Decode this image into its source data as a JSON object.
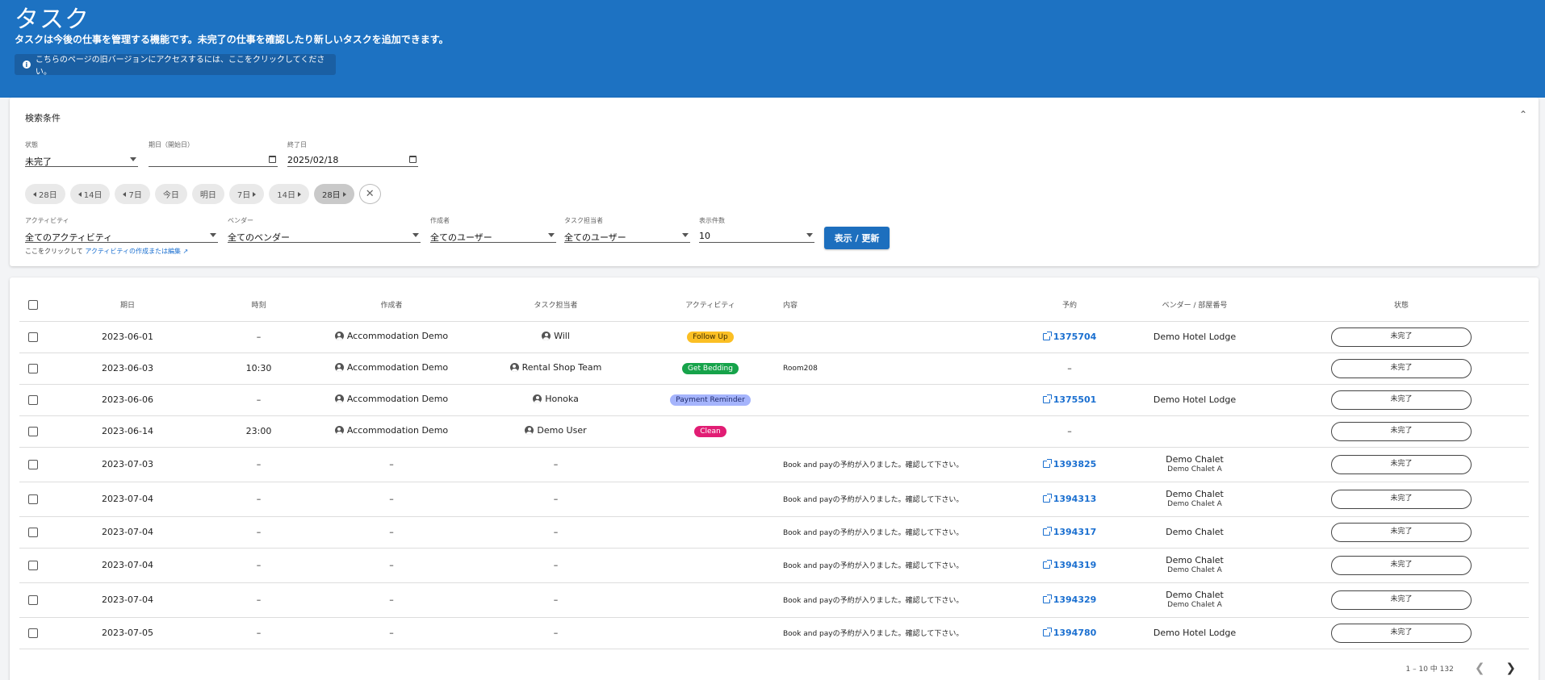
{
  "header": {
    "title": "タスク",
    "subtitle": "タスクは今後の仕事を管理する機能です。未完了の仕事を確認したり新しいタスクを追加できます。",
    "old_version_link": "こちらのページの旧バージョンにアクセスするには、ここをクリックしてください。"
  },
  "filters": {
    "title": "検索条件",
    "status": {
      "label": "状態",
      "value": "未完了"
    },
    "start_date": {
      "label": "期日（開始日）",
      "value": ""
    },
    "end_date": {
      "label": "終了日",
      "value": "2025/02/18"
    },
    "chips": [
      "28日",
      "14日",
      "7日",
      "今日",
      "明日",
      "7日",
      "14日",
      "28日"
    ],
    "activity": {
      "label": "アクティビティ",
      "value": "全てのアクティビティ"
    },
    "vendor": {
      "label": "ベンダー",
      "value": "全てのベンダー"
    },
    "creator": {
      "label": "作成者",
      "value": "全てのユーザー"
    },
    "assignee": {
      "label": "タスク担当者",
      "value": "全てのユーザー"
    },
    "per_page": {
      "label": "表示件数",
      "value": "10"
    },
    "help_prefix": "ここをクリックして",
    "help_link": "アクティビティの作成または編集",
    "submit_label": "表示 / 更新"
  },
  "table": {
    "columns": [
      "期日",
      "時刻",
      "作成者",
      "タスク担当者",
      "アクティビティ",
      "内容",
      "予約",
      "ベンダー / 部屋番号",
      "状態"
    ],
    "rows": [
      {
        "date": "2023-06-01",
        "time": "–",
        "creator": "Accommodation Demo",
        "assignee": "Will",
        "activity": "Follow Up",
        "content": "",
        "reservation": "1375704",
        "vendor": "Demo Hotel Lodge",
        "room": "",
        "status": "未完了"
      },
      {
        "date": "2023-06-03",
        "time": "10:30",
        "creator": "Accommodation Demo",
        "assignee": "Rental Shop Team",
        "activity": "Get Bedding",
        "content": "Room208",
        "reservation": "",
        "vendor": "",
        "room": "",
        "status": "未完了"
      },
      {
        "date": "2023-06-06",
        "time": "–",
        "creator": "Accommodation Demo",
        "assignee": "Honoka",
        "activity": "Payment Reminder",
        "content": "",
        "reservation": "1375501",
        "vendor": "Demo Hotel Lodge",
        "room": "",
        "status": "未完了"
      },
      {
        "date": "2023-06-14",
        "time": "23:00",
        "creator": "Accommodation Demo",
        "assignee": "Demo User",
        "activity": "Clean",
        "content": "",
        "reservation": "",
        "vendor": "",
        "room": "",
        "status": "未完了"
      },
      {
        "date": "2023-07-03",
        "time": "–",
        "creator": "",
        "assignee": "",
        "activity": "",
        "content": "Book and payの予約が入りました。確認して下さい。",
        "reservation": "1393825",
        "vendor": "Demo Chalet",
        "room": "Demo Chalet A",
        "status": "未完了"
      },
      {
        "date": "2023-07-04",
        "time": "–",
        "creator": "",
        "assignee": "",
        "activity": "",
        "content": "Book and payの予約が入りました。確認して下さい。",
        "reservation": "1394313",
        "vendor": "Demo Chalet",
        "room": "Demo Chalet A",
        "status": "未完了"
      },
      {
        "date": "2023-07-04",
        "time": "–",
        "creator": "",
        "assignee": "",
        "activity": "",
        "content": "Book and payの予約が入りました。確認して下さい。",
        "reservation": "1394317",
        "vendor": "Demo Chalet",
        "room": "",
        "status": "未完了"
      },
      {
        "date": "2023-07-04",
        "time": "–",
        "creator": "",
        "assignee": "",
        "activity": "",
        "content": "Book and payの予約が入りました。確認して下さい。",
        "reservation": "1394319",
        "vendor": "Demo Chalet",
        "room": "Demo Chalet A",
        "status": "未完了"
      },
      {
        "date": "2023-07-04",
        "time": "–",
        "creator": "",
        "assignee": "",
        "activity": "",
        "content": "Book and payの予約が入りました。確認して下さい。",
        "reservation": "1394329",
        "vendor": "Demo Chalet",
        "room": "Demo Chalet A",
        "status": "未完了"
      },
      {
        "date": "2023-07-05",
        "time": "–",
        "creator": "",
        "assignee": "",
        "activity": "",
        "content": "Book and payの予約が入りました。確認して下さい。",
        "reservation": "1394780",
        "vendor": "Demo Hotel Lodge",
        "room": "",
        "status": "未完了"
      }
    ]
  },
  "activity_colors": {
    "Follow Up": {
      "bg": "#fbbf24",
      "fg": "#3b2a00"
    },
    "Get Bedding": {
      "bg": "#16a34a",
      "fg": "#ffffff"
    },
    "Payment Reminder": {
      "bg": "#a5b4fc",
      "fg": "#1e2a6b"
    },
    "Clean": {
      "bg": "#e11d74",
      "fg": "#ffffff"
    }
  },
  "pagination": {
    "range": "1 – 10 中 132"
  }
}
